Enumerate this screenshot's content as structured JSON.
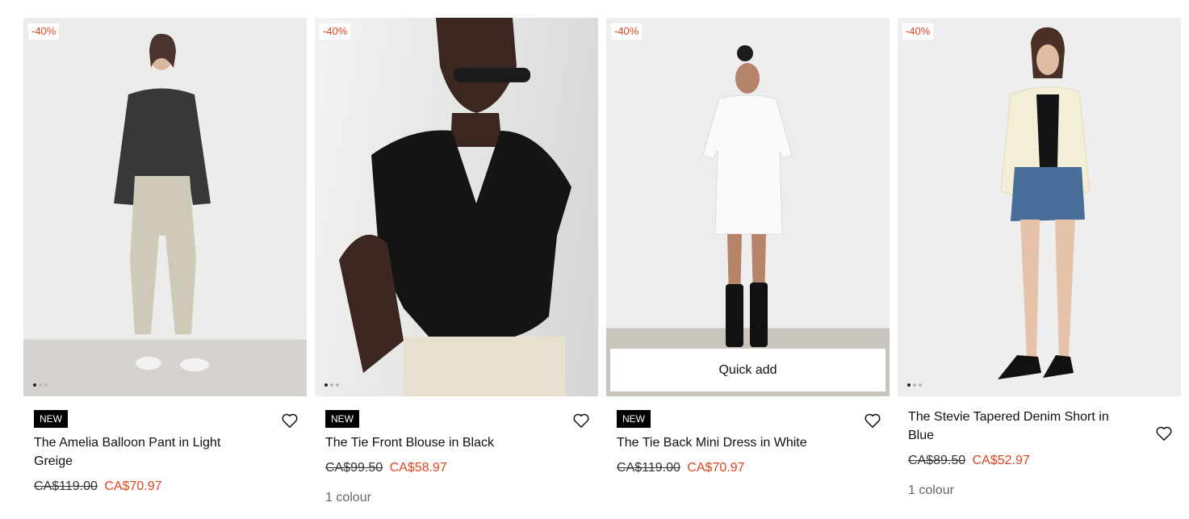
{
  "products": [
    {
      "discount": "-40%",
      "badge": "NEW",
      "name": "The Amelia Balloon Pant in Light Greige",
      "old_price": "CA$119.00",
      "sale_price": "CA$70.97",
      "colours": "",
      "icons": {
        "wishlist": "heart-icon"
      }
    },
    {
      "discount": "-40%",
      "badge": "NEW",
      "name": "The Tie Front Blouse in Black",
      "old_price": "CA$99.50",
      "sale_price": "CA$58.97",
      "colours": "1 colour",
      "icons": {
        "wishlist": "heart-icon"
      }
    },
    {
      "discount": "-40%",
      "badge": "NEW",
      "name": "The Tie Back Mini Dress in White",
      "old_price": "CA$119.00",
      "sale_price": "CA$70.97",
      "quick_add": "Quick add",
      "icons": {
        "wishlist": "heart-icon"
      }
    },
    {
      "discount": "-40%",
      "name": "The Stevie Tapered Denim Short in Blue",
      "old_price": "CA$89.50",
      "sale_price": "CA$52.97",
      "colours": "1 colour",
      "icons": {
        "wishlist": "heart-icon"
      }
    }
  ],
  "colors": {
    "sale": "#e0441f",
    "badge_bg": "#000000"
  }
}
